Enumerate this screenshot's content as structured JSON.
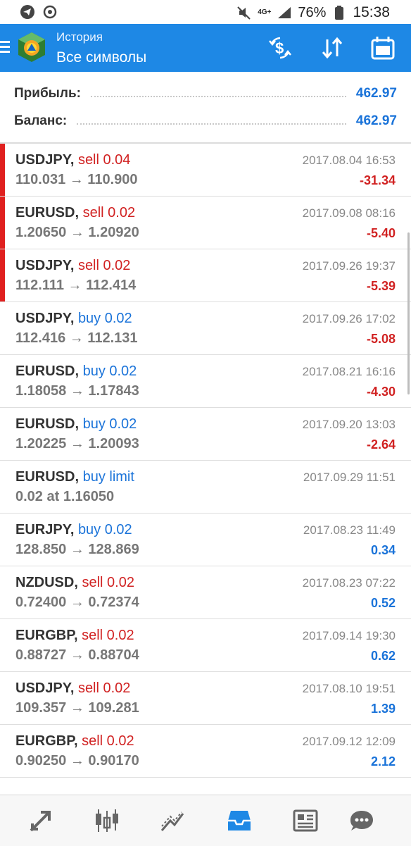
{
  "status_bar": {
    "left_icons": [
      "telegram-icon",
      "sync-icon"
    ],
    "network": "4G+",
    "battery_percent": "76%",
    "time": "15:38"
  },
  "header": {
    "subtitle": "История",
    "title": "Все символы",
    "accent_color": "#1e88e5"
  },
  "summary": {
    "profit_label": "Прибыль:",
    "profit_value": "462.97",
    "balance_label": "Баланс:",
    "balance_value": "462.97"
  },
  "trades": [
    {
      "symbol": "USDJPY,",
      "type": "sell 0.04",
      "side": "sell",
      "prices": "110.031 → 110.900",
      "date": "2017.08.04 16:53",
      "profit": "-31.34",
      "loss": true
    },
    {
      "symbol": "EURUSD,",
      "type": "sell 0.02",
      "side": "sell",
      "prices": "1.20650 → 1.20920",
      "date": "2017.09.08 08:16",
      "profit": "-5.40",
      "loss": true
    },
    {
      "symbol": "USDJPY,",
      "type": "sell 0.02",
      "side": "sell",
      "prices": "112.111 → 112.414",
      "date": "2017.09.26 19:37",
      "profit": "-5.39",
      "loss": true
    },
    {
      "symbol": "USDJPY,",
      "type": "buy 0.02",
      "side": "buy",
      "prices": "112.416 → 112.131",
      "date": "2017.09.26 17:02",
      "profit": "-5.08",
      "loss": true
    },
    {
      "symbol": "EURUSD,",
      "type": "buy 0.02",
      "side": "buy",
      "prices": "1.18058 → 1.17843",
      "date": "2017.08.21 16:16",
      "profit": "-4.30",
      "loss": true
    },
    {
      "symbol": "EURUSD,",
      "type": "buy 0.02",
      "side": "buy",
      "prices": "1.20225 → 1.20093",
      "date": "2017.09.20 13:03",
      "profit": "-2.64",
      "loss": true
    },
    {
      "symbol": "EURUSD,",
      "type": "buy limit",
      "side": "buy",
      "prices": "0.02 at 1.16050",
      "date": "2017.09.29 11:51",
      "profit": "",
      "loss": false
    },
    {
      "symbol": "EURJPY,",
      "type": "buy 0.02",
      "side": "buy",
      "prices": "128.850 → 128.869",
      "date": "2017.08.23 11:49",
      "profit": "0.34",
      "loss": false
    },
    {
      "symbol": "NZDUSD,",
      "type": "sell 0.02",
      "side": "sell",
      "prices": "0.72400 → 0.72374",
      "date": "2017.08.23 07:22",
      "profit": "0.52",
      "loss": false
    },
    {
      "symbol": "EURGBP,",
      "type": "sell 0.02",
      "side": "sell",
      "prices": "0.88727 → 0.88704",
      "date": "2017.09.14 19:30",
      "profit": "0.62",
      "loss": false
    },
    {
      "symbol": "USDJPY,",
      "type": "sell 0.02",
      "side": "sell",
      "prices": "109.357 → 109.281",
      "date": "2017.08.10 19:51",
      "profit": "1.39",
      "loss": false
    },
    {
      "symbol": "EURGBP,",
      "type": "sell 0.02",
      "side": "sell",
      "prices": "0.90250 → 0.90170",
      "date": "2017.09.12 12:09",
      "profit": "2.12",
      "loss": false
    }
  ],
  "highlighted_rows": [
    0,
    1,
    2
  ],
  "colors": {
    "sell": "#d12222",
    "buy": "#1a73d9",
    "loss": "#d12222",
    "gain": "#1a73d9",
    "loss_marker": "#e0201f"
  },
  "bottom_nav": [
    {
      "icon": "quotes-icon",
      "active": false
    },
    {
      "icon": "chart-icon",
      "active": false
    },
    {
      "icon": "trade-icon",
      "active": false
    },
    {
      "icon": "history-icon",
      "active": true
    },
    {
      "icon": "news-icon",
      "active": false
    },
    {
      "icon": "chat-icon",
      "active": false
    }
  ]
}
